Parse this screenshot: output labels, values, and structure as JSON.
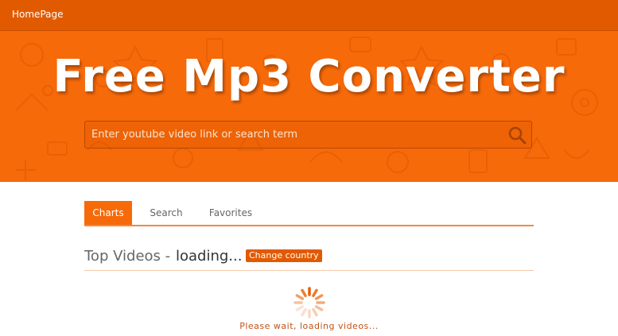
{
  "nav": {
    "home_label": "HomePage"
  },
  "hero": {
    "title": "Free Mp3 Converter",
    "search_placeholder": "Enter youtube video link or search term"
  },
  "tabs": [
    {
      "label": "Charts",
      "active": true
    },
    {
      "label": "Search",
      "active": false
    },
    {
      "label": "Favorites",
      "active": false
    }
  ],
  "section": {
    "title": "Top Videos -",
    "status": "loading...",
    "change_country_label": "Change country"
  },
  "loader": {
    "message": "Please wait, loading videos..."
  },
  "colors": {
    "brand_orange": "#f66a0a",
    "nav_orange": "#e25a00",
    "text_gray": "#666666"
  },
  "icons": {
    "search": "search-icon",
    "spinner": "spinner-icon"
  }
}
